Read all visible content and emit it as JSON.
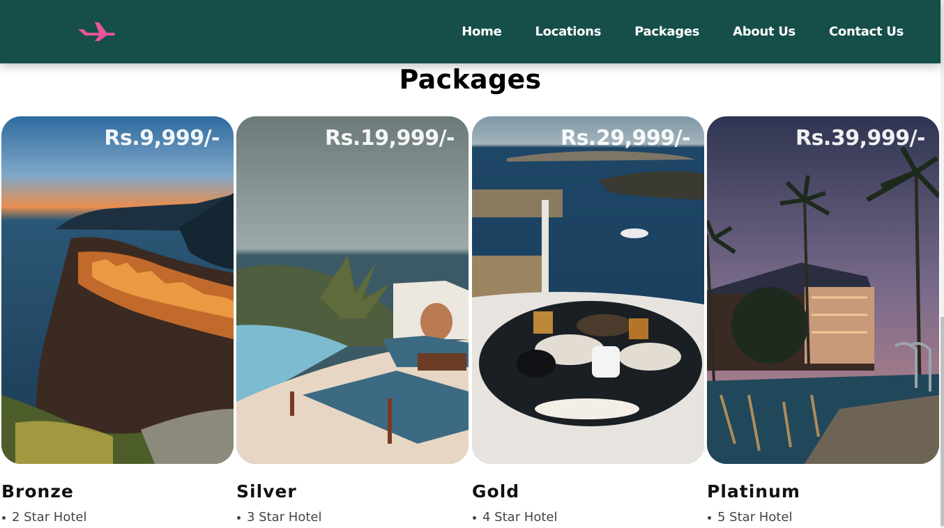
{
  "nav": {
    "logo_icon": "airplane-icon",
    "links": [
      "Home",
      "Locations",
      "Packages",
      "About Us",
      "Contact Us"
    ]
  },
  "section": {
    "title": "Packages"
  },
  "packages": [
    {
      "tier": "Bronze",
      "price": "Rs.9,999/-",
      "feature": "2 Star Hotel"
    },
    {
      "tier": "Silver",
      "price": "Rs.19,999/-",
      "feature": "3 Star Hotel"
    },
    {
      "tier": "Gold",
      "price": "Rs.29,999/-",
      "feature": "4 Star Hotel"
    },
    {
      "tier": "Platinum",
      "price": "Rs.39,999/-",
      "feature": "5 Star Hotel"
    }
  ],
  "colors": {
    "nav_bg": "#164e4a",
    "logo": "#e8559a",
    "text": "#000000"
  }
}
